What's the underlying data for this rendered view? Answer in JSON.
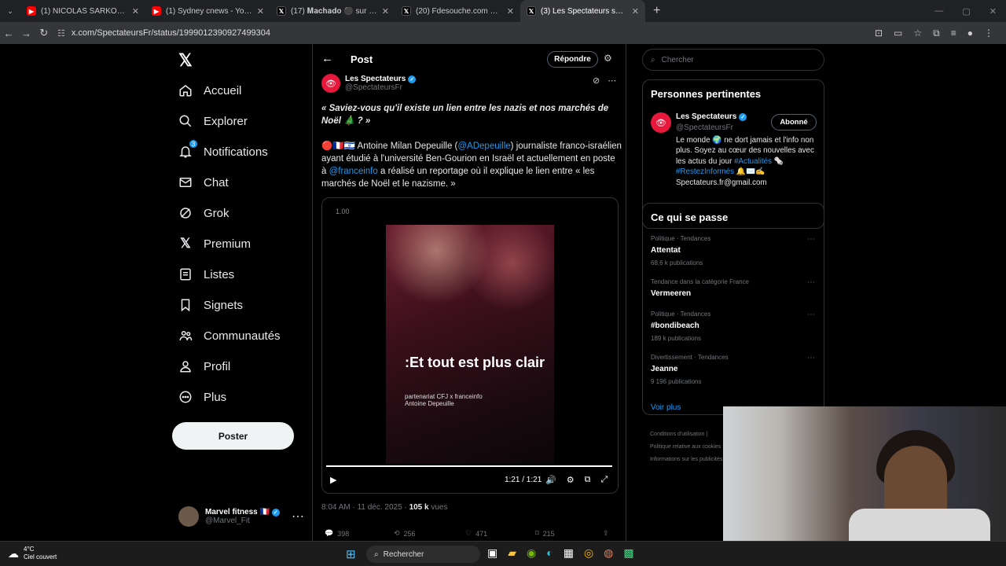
{
  "browser": {
    "tabs": [
      {
        "title": "(1) NICOLAS SARKOZY : INTERV",
        "favicon": "youtube"
      },
      {
        "title": "(1) Sydney cnews - YouTube",
        "favicon": "youtube"
      },
      {
        "title": "(17) 𝐌𝐚𝐜𝐡𝐚𝐝𝐨 ⚫ sur X : \"https",
        "favicon": "x"
      },
      {
        "title": "(20) Fdesouche.com est une re",
        "favicon": "x"
      },
      {
        "title": "(3) Les Spectateurs sur X : \"« Sa",
        "favicon": "x",
        "active": true
      }
    ],
    "url": "x.com/SpectateursFr/status/1999012390927499304"
  },
  "sidebar": {
    "items": [
      {
        "label": "Accueil",
        "icon": "home-icon"
      },
      {
        "label": "Explorer",
        "icon": "search-icon"
      },
      {
        "label": "Notifications",
        "icon": "bell-icon",
        "badge": "3"
      },
      {
        "label": "Chat",
        "icon": "mail-icon"
      },
      {
        "label": "Grok",
        "icon": "grok-icon"
      },
      {
        "label": "Premium",
        "icon": "x-icon"
      },
      {
        "label": "Listes",
        "icon": "list-icon"
      },
      {
        "label": "Signets",
        "icon": "bookmark-icon"
      },
      {
        "label": "Communautés",
        "icon": "people-icon"
      },
      {
        "label": "Profil",
        "icon": "person-icon"
      },
      {
        "label": "Plus",
        "icon": "more-circle-icon"
      }
    ],
    "post_button": "Poster",
    "account": {
      "name": "Marvel fitness 🇫🇷",
      "handle": "@Marvel_Fit"
    }
  },
  "main": {
    "title": "Post",
    "reply_button": "Répondre",
    "author": {
      "name": "Les Spectateurs",
      "handle": "@SpectateursFr"
    },
    "quote": "« Saviez-vous qu'il existe un lien entre les nazis et nos marchés de Noël 🎄 ? »",
    "body_start": "🔴🇫🇷🇮🇱 Antoine Milan Depeuille (",
    "mention1": "@ADepeuille",
    "body_mid": ") journaliste franco-israélien ayant étudié à l'université Ben-Gourion en Israël et actuellement en poste à ",
    "mention2": "@franceinfo",
    "body_end": " a réalisé un reportage où il explique le lien entre « les marchés de Noël et le nazisme. »",
    "video": {
      "speed": "1.00",
      "overlay_title": ":Et tout est plus clair",
      "overlay_sub1": "partenariat CFJ x franceinfo",
      "overlay_sub2": "Antoine Depeuille",
      "time": "1:21 / 1:21",
      "progress": 1.0
    },
    "meta_time": "8:04 AM · 11 déc. 2025 · ",
    "views": "105 k",
    "views_label": " vues",
    "stats": {
      "replies": "398",
      "reposts": "256",
      "likes": "471",
      "bookmarks": "215"
    }
  },
  "right": {
    "search_placeholder": "Chercher",
    "relevant": {
      "heading": "Personnes pertinentes",
      "name": "Les Spectateurs",
      "handle": "@SpectateursFr",
      "follow": "Abonné",
      "bio_1": "Le monde 🌍 ne dort jamais et l'info non plus. Soyez au cœur des nouvelles avec les actus du jour ",
      "hashtag1": "#Actualités",
      "bio_2": " 🗞️ ",
      "hashtag2": "#RestezInformés",
      "bio_3": " 🔔✉️✍️ Spectateurs.fr@gmail.com"
    },
    "trends": {
      "heading": "Ce qui se passe",
      "items": [
        {
          "category": "Politique · Tendances",
          "name": "Attentat",
          "count": "68,6 k publications"
        },
        {
          "category": "Tendance dans la catégorie France",
          "name": "Vermeeren",
          "count": ""
        },
        {
          "category": "Politique · Tendances",
          "name": "#bondibeach",
          "count": "189 k publications"
        },
        {
          "category": "Divertissement · Tendances",
          "name": "Jeanne",
          "count": "9 196 publications"
        }
      ],
      "more": "Voir plus"
    },
    "footer": [
      "Conditions d'utilisation |",
      "Politique relative aux cookies",
      "Informations sur les publicités"
    ]
  },
  "taskbar": {
    "temp": "4°C",
    "weather": "Ciel couvert",
    "search": "Rechercher"
  }
}
